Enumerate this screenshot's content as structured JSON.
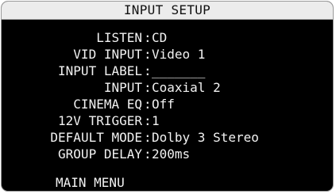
{
  "title": "INPUT SETUP",
  "settings": [
    {
      "label": "LISTEN",
      "value": "CD"
    },
    {
      "label": "VID INPUT",
      "value": "Video 1"
    },
    {
      "label": "INPUT LABEL",
      "value": "_______"
    },
    {
      "label": "INPUT",
      "value": "Coaxial 2"
    },
    {
      "label": "CINEMA EQ",
      "value": "Off"
    },
    {
      "label": "12V TRIGGER",
      "value": "1"
    },
    {
      "label": "DEFAULT MODE",
      "value": "Dolby 3 Stereo"
    },
    {
      "label": "GROUP DELAY",
      "value": "200ms"
    }
  ],
  "menu": {
    "main_menu_label": "MAIN MENU"
  },
  "colors": {
    "background": "#000000",
    "text": "#f2f2f2",
    "title_bar": "#ececec",
    "title_text": "#111111",
    "border": "#9a9a9a"
  }
}
